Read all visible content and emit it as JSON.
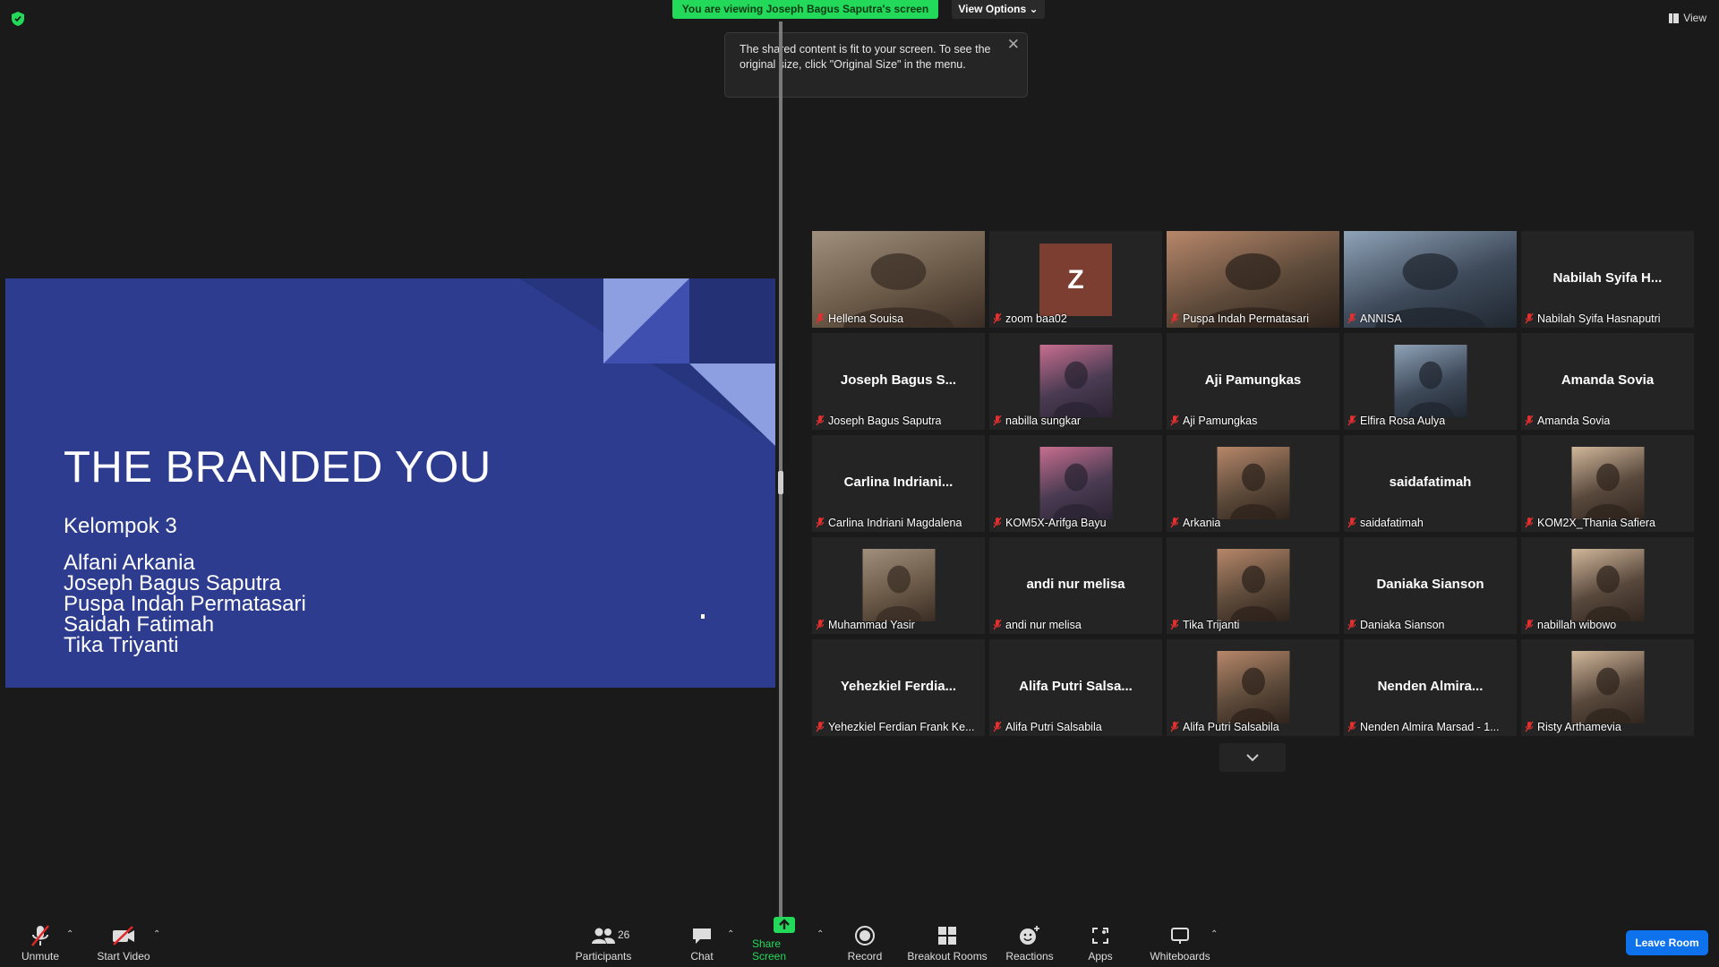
{
  "banner": {
    "viewing_text": "You are viewing Joseph Bagus Saputra's screen",
    "view_options_label": "View Options",
    "view_label": "View"
  },
  "tooltip": {
    "text": "The shared content is fit to your screen. To see the original size, click \"Original Size\" in the menu."
  },
  "slide": {
    "title": "THE BRANDED YOU",
    "subtitle": "Kelompok 3",
    "members": [
      "Alfani Arkania",
      "Joseph Bagus Saputra",
      "Puspa Indah Permatasari",
      "Saidah Fatimah",
      "Tika Triyanti"
    ]
  },
  "participants": [
    {
      "label": "Hellena Souisa",
      "display": "",
      "kind": "photo-full"
    },
    {
      "label": "zoom baa02",
      "display": "Z",
      "kind": "avatar"
    },
    {
      "label": "Puspa Indah Permatasari",
      "display": "",
      "kind": "photo-full",
      "active": true
    },
    {
      "label": "ANNISA",
      "display": "",
      "kind": "photo-full"
    },
    {
      "label": "Nabilah Syifa Hasnaputri",
      "display": "Nabilah Syifa H...",
      "kind": "name"
    },
    {
      "label": "Joseph Bagus Saputra",
      "display": "Joseph Bagus S...",
      "kind": "name"
    },
    {
      "label": "nabilla sungkar",
      "display": "",
      "kind": "photo"
    },
    {
      "label": "Aji Pamungkas",
      "display": "Aji Pamungkas",
      "kind": "name"
    },
    {
      "label": "Elfira Rosa Aulya",
      "display": "",
      "kind": "photo"
    },
    {
      "label": "Amanda Sovia",
      "display": "Amanda Sovia",
      "kind": "name"
    },
    {
      "label": "Carlina Indriani Magdalena",
      "display": "Carlina Indriani...",
      "kind": "name"
    },
    {
      "label": "KOM5X-Arifga Bayu",
      "display": "",
      "kind": "photo"
    },
    {
      "label": "Arkania",
      "display": "",
      "kind": "photo"
    },
    {
      "label": "saidafatimah",
      "display": "saidafatimah",
      "kind": "name"
    },
    {
      "label": "KOM2X_Thania Safiera",
      "display": "",
      "kind": "photo"
    },
    {
      "label": "Muhammad Yasir",
      "display": "",
      "kind": "photo"
    },
    {
      "label": "andi nur melisa",
      "display": "andi nur melisa",
      "kind": "name"
    },
    {
      "label": "Tika Trijanti",
      "display": "",
      "kind": "photo"
    },
    {
      "label": "Daniaka Sianson",
      "display": "Daniaka Sianson",
      "kind": "name"
    },
    {
      "label": "nabillah wibowo",
      "display": "",
      "kind": "photo"
    },
    {
      "label": "Yehezkiel Ferdian Frank Ke...",
      "display": "Yehezkiel Ferdia...",
      "kind": "name"
    },
    {
      "label": "Alifa Putri Salsabila",
      "display": "Alifa Putri Salsa...",
      "kind": "name"
    },
    {
      "label": "Alifa Putri Salsabila",
      "display": "",
      "kind": "photo"
    },
    {
      "label": "Nenden Almira Marsad - 1...",
      "display": "Nenden Almira...",
      "kind": "name"
    },
    {
      "label": "Risty Arthamevia",
      "display": "",
      "kind": "photo"
    }
  ],
  "toolbar": {
    "unmute": "Unmute",
    "start_video": "Start Video",
    "participants": "Participants",
    "participants_count": "26",
    "chat": "Chat",
    "share_screen": "Share Screen",
    "record": "Record",
    "breakout_rooms": "Breakout Rooms",
    "reactions": "Reactions",
    "apps": "Apps",
    "whiteboards": "Whiteboards",
    "leave_room": "Leave Room"
  },
  "colors": {
    "accent_green": "#23d959",
    "leave_blue": "#0e72ed",
    "slide_blue": "#2e3c8f",
    "active_speaker": "#e9e64a"
  }
}
